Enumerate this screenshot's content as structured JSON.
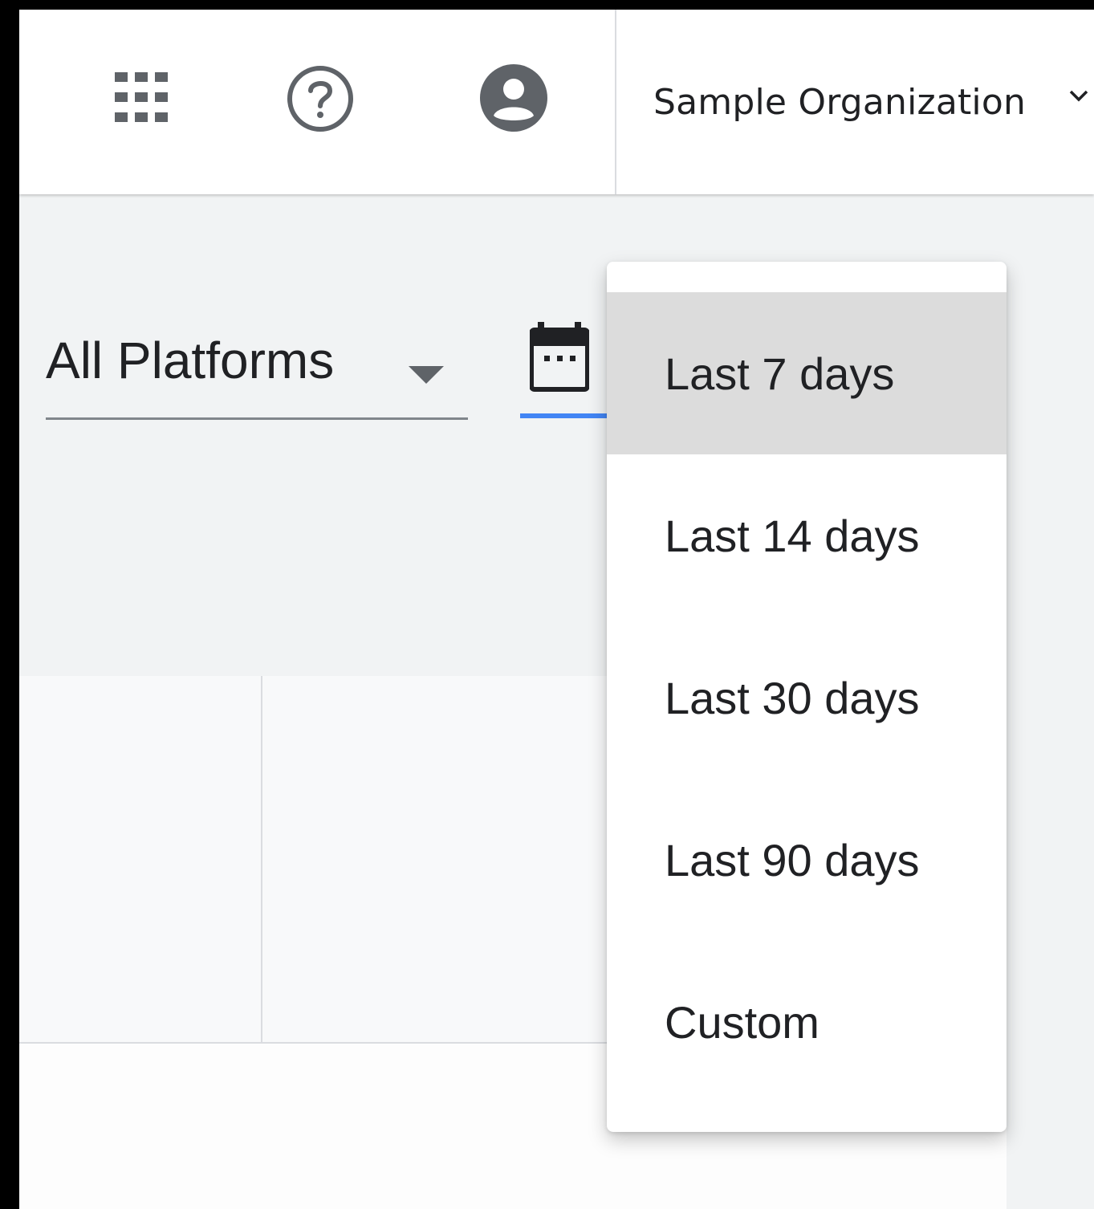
{
  "header": {
    "icons": {
      "apps": "apps-grid-icon",
      "help": "help-circle-icon",
      "account": "account-circle-icon",
      "org_chevron": "chevron-down-icon"
    },
    "organization": "Sample Organization"
  },
  "filters": {
    "platform": {
      "value": "All Platforms",
      "icon": "dropdown-arrow-icon"
    },
    "date_range": {
      "icon": "calendar-icon",
      "accent_color": "#4285f4"
    }
  },
  "date_menu": {
    "selected_index": 0,
    "options": [
      "Last 7 days",
      "Last 14 days",
      "Last 30 days",
      "Last 90 days",
      "Custom"
    ]
  },
  "colors": {
    "page_background": "#f1f3f4",
    "menu_selected": "#dcdcdc",
    "text": "#202124"
  }
}
